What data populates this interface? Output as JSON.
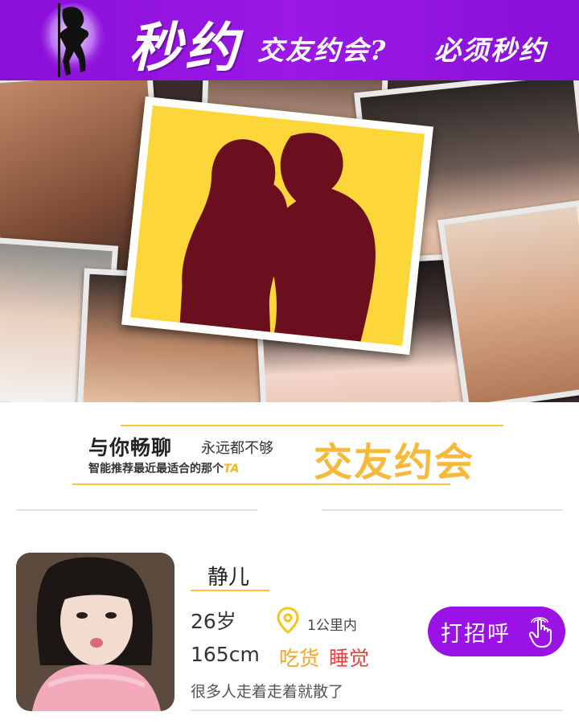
{
  "header": {
    "brand": "秒约",
    "slogan": "交友约会?",
    "slogan2": "必须秒约",
    "background": "#8a0fd8",
    "logo_icon": "dancer-silhouette-icon"
  },
  "banner": {
    "center_card_color": "#fdd63a",
    "center_icon": "couple-silhouette-icon"
  },
  "tagline": {
    "main": "与你畅聊",
    "sub": "永远都不够",
    "small": "智能推荐最近最适合的那个",
    "small_ta": "TA",
    "big": "交友约会",
    "accent": "#f7b93a"
  },
  "profile": {
    "name": "静儿",
    "age": "26岁",
    "height": "165cm",
    "distance": "1公里内",
    "tags": [
      "吃货",
      "睡觉"
    ],
    "motto": "很多人走着走着就散了",
    "greet_label": "打招呼",
    "location_icon": "location-pin-icon",
    "hand_icon": "tap-hand-icon",
    "button_color": "#9a12e6"
  }
}
